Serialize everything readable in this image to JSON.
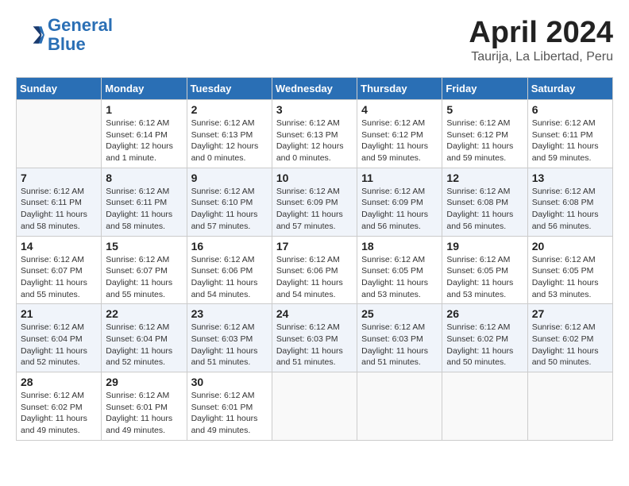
{
  "header": {
    "logo_line1": "General",
    "logo_line2": "Blue",
    "month": "April 2024",
    "location": "Taurija, La Libertad, Peru"
  },
  "days_of_week": [
    "Sunday",
    "Monday",
    "Tuesday",
    "Wednesday",
    "Thursday",
    "Friday",
    "Saturday"
  ],
  "weeks": [
    [
      {
        "day": "",
        "info": ""
      },
      {
        "day": "1",
        "info": "Sunrise: 6:12 AM\nSunset: 6:14 PM\nDaylight: 12 hours\nand 1 minute."
      },
      {
        "day": "2",
        "info": "Sunrise: 6:12 AM\nSunset: 6:13 PM\nDaylight: 12 hours\nand 0 minutes."
      },
      {
        "day": "3",
        "info": "Sunrise: 6:12 AM\nSunset: 6:13 PM\nDaylight: 12 hours\nand 0 minutes."
      },
      {
        "day": "4",
        "info": "Sunrise: 6:12 AM\nSunset: 6:12 PM\nDaylight: 11 hours\nand 59 minutes."
      },
      {
        "day": "5",
        "info": "Sunrise: 6:12 AM\nSunset: 6:12 PM\nDaylight: 11 hours\nand 59 minutes."
      },
      {
        "day": "6",
        "info": "Sunrise: 6:12 AM\nSunset: 6:11 PM\nDaylight: 11 hours\nand 59 minutes."
      }
    ],
    [
      {
        "day": "7",
        "info": "Sunrise: 6:12 AM\nSunset: 6:11 PM\nDaylight: 11 hours\nand 58 minutes."
      },
      {
        "day": "8",
        "info": "Sunrise: 6:12 AM\nSunset: 6:11 PM\nDaylight: 11 hours\nand 58 minutes."
      },
      {
        "day": "9",
        "info": "Sunrise: 6:12 AM\nSunset: 6:10 PM\nDaylight: 11 hours\nand 57 minutes."
      },
      {
        "day": "10",
        "info": "Sunrise: 6:12 AM\nSunset: 6:09 PM\nDaylight: 11 hours\nand 57 minutes."
      },
      {
        "day": "11",
        "info": "Sunrise: 6:12 AM\nSunset: 6:09 PM\nDaylight: 11 hours\nand 56 minutes."
      },
      {
        "day": "12",
        "info": "Sunrise: 6:12 AM\nSunset: 6:08 PM\nDaylight: 11 hours\nand 56 minutes."
      },
      {
        "day": "13",
        "info": "Sunrise: 6:12 AM\nSunset: 6:08 PM\nDaylight: 11 hours\nand 56 minutes."
      }
    ],
    [
      {
        "day": "14",
        "info": "Sunrise: 6:12 AM\nSunset: 6:07 PM\nDaylight: 11 hours\nand 55 minutes."
      },
      {
        "day": "15",
        "info": "Sunrise: 6:12 AM\nSunset: 6:07 PM\nDaylight: 11 hours\nand 55 minutes."
      },
      {
        "day": "16",
        "info": "Sunrise: 6:12 AM\nSunset: 6:06 PM\nDaylight: 11 hours\nand 54 minutes."
      },
      {
        "day": "17",
        "info": "Sunrise: 6:12 AM\nSunset: 6:06 PM\nDaylight: 11 hours\nand 54 minutes."
      },
      {
        "day": "18",
        "info": "Sunrise: 6:12 AM\nSunset: 6:05 PM\nDaylight: 11 hours\nand 53 minutes."
      },
      {
        "day": "19",
        "info": "Sunrise: 6:12 AM\nSunset: 6:05 PM\nDaylight: 11 hours\nand 53 minutes."
      },
      {
        "day": "20",
        "info": "Sunrise: 6:12 AM\nSunset: 6:05 PM\nDaylight: 11 hours\nand 53 minutes."
      }
    ],
    [
      {
        "day": "21",
        "info": "Sunrise: 6:12 AM\nSunset: 6:04 PM\nDaylight: 11 hours\nand 52 minutes."
      },
      {
        "day": "22",
        "info": "Sunrise: 6:12 AM\nSunset: 6:04 PM\nDaylight: 11 hours\nand 52 minutes."
      },
      {
        "day": "23",
        "info": "Sunrise: 6:12 AM\nSunset: 6:03 PM\nDaylight: 11 hours\nand 51 minutes."
      },
      {
        "day": "24",
        "info": "Sunrise: 6:12 AM\nSunset: 6:03 PM\nDaylight: 11 hours\nand 51 minutes."
      },
      {
        "day": "25",
        "info": "Sunrise: 6:12 AM\nSunset: 6:03 PM\nDaylight: 11 hours\nand 51 minutes."
      },
      {
        "day": "26",
        "info": "Sunrise: 6:12 AM\nSunset: 6:02 PM\nDaylight: 11 hours\nand 50 minutes."
      },
      {
        "day": "27",
        "info": "Sunrise: 6:12 AM\nSunset: 6:02 PM\nDaylight: 11 hours\nand 50 minutes."
      }
    ],
    [
      {
        "day": "28",
        "info": "Sunrise: 6:12 AM\nSunset: 6:02 PM\nDaylight: 11 hours\nand 49 minutes."
      },
      {
        "day": "29",
        "info": "Sunrise: 6:12 AM\nSunset: 6:01 PM\nDaylight: 11 hours\nand 49 minutes."
      },
      {
        "day": "30",
        "info": "Sunrise: 6:12 AM\nSunset: 6:01 PM\nDaylight: 11 hours\nand 49 minutes."
      },
      {
        "day": "",
        "info": ""
      },
      {
        "day": "",
        "info": ""
      },
      {
        "day": "",
        "info": ""
      },
      {
        "day": "",
        "info": ""
      }
    ]
  ]
}
